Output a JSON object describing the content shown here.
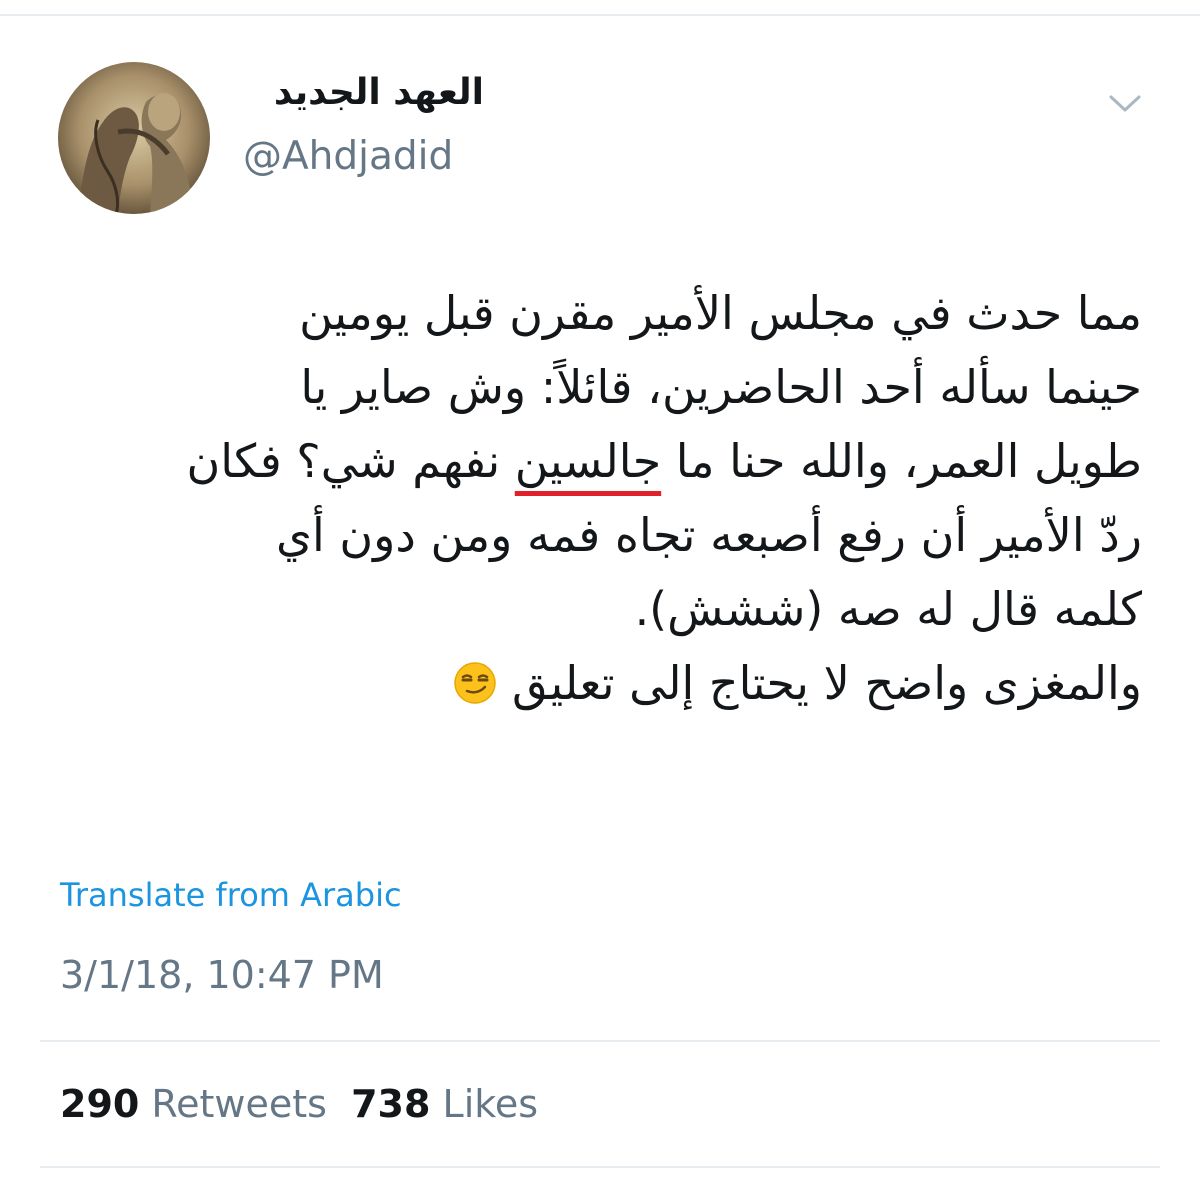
{
  "author": {
    "display_name": "العهد الجديد",
    "handle": "@Ahdjadid"
  },
  "tweet": {
    "lines": [
      "مما حدث في مجلس الأمير مقرن قبل يومين",
      "حينما سأله أحد الحاضرين، قائلاً: وش صاير يا",
      "شي؟ فكان",
      "جالسين",
      "طويل العمر، والله حنا ما",
      "ردّ الأمير أن رفع أصبعه تجاه فمه ومن دون أي",
      "كلمه قال له صه (ششش).",
      "والمغزى واضح لا يحتاج إلى تعليق"
    ],
    "underlined_text": "ما جالسين نفهم",
    "emoji": "smirking-face-emoji"
  },
  "translate_label": "Translate from Arabic",
  "timestamp": "3/1/18, 10:47 PM",
  "stats": {
    "retweets_count": "290",
    "retweets_label": "Retweets",
    "likes_count": "738",
    "likes_label": "Likes"
  },
  "colors": {
    "link": "#1b95e0",
    "secondary_text": "#657786",
    "underline": "#e0202a",
    "divider": "#e6ecf0"
  }
}
